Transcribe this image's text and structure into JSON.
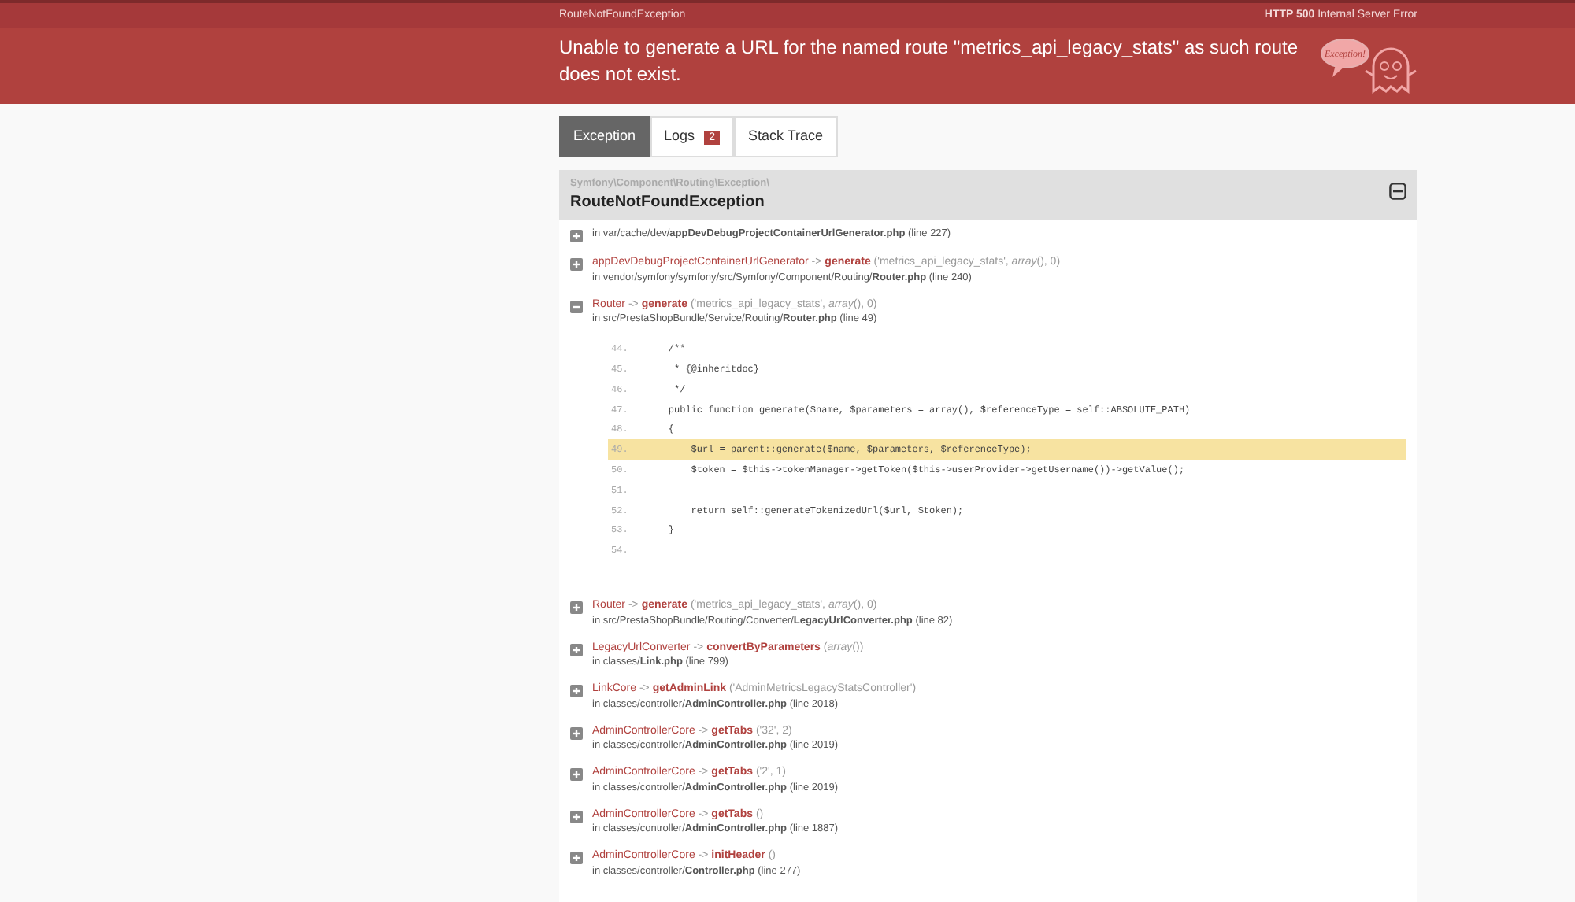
{
  "header": {
    "exception_name": "RouteNotFoundException",
    "status": "**HTTP 500** Internal Server Error",
    "message": "Unable to generate a URL for the named route \"metrics_api_legacy_stats\" as such route does not exist.",
    "logo_text": "Exception!"
  },
  "tabs": [
    {
      "label": "Exception",
      "selected": true
    },
    {
      "label": "Logs",
      "badge": "2",
      "selected": false
    },
    {
      "label": "Stack Trace",
      "selected": false
    }
  ],
  "exception": {
    "namespace": "Symfony\\Component\\Routing\\Exception\\",
    "class": "RouteNotFoundException",
    "expanded": true,
    "frames": [
      {
        "path": "in var/cache/dev/**appDevDebugProjectContainerUrlGenerator.php** (line 227)",
        "expanded": false
      },
      {
        "class": "appDevDebugProjectContainerUrlGenerator",
        "separator": "->",
        "call": "generate",
        "args": "('metrics_api_legacy_stats', *array*(), 0)",
        "path": "in vendor/symfony/symfony/src/Symfony/Component/Routing/**Router.php** (line 240)",
        "expanded": false
      },
      {
        "class": "Router",
        "separator": "->",
        "call": "generate",
        "args": "('metrics_api_legacy_stats', *array*(), 0)",
        "path": "in src/PrestaShopBundle/Service/Routing/**Router.php** (line 49)",
        "expanded": true,
        "code": [
          {
            "number": "44.",
            "text": "    /**",
            "highlighted": false
          },
          {
            "number": "45.",
            "text": "     * {@inheritdoc}",
            "highlighted": false
          },
          {
            "number": "46.",
            "text": "     */",
            "highlighted": false
          },
          {
            "number": "47.",
            "text": "    public function generate($name, $parameters = array(), $referenceType = self::ABSOLUTE_PATH)",
            "highlighted": false
          },
          {
            "number": "48.",
            "text": "    {",
            "highlighted": false
          },
          {
            "number": "49.",
            "text": "        $url = parent::generate($name, $parameters, $referenceType);",
            "highlighted": true
          },
          {
            "number": "50.",
            "text": "        $token = $this->tokenManager->getToken($this->userProvider->getUsername())->getValue();",
            "highlighted": false
          },
          {
            "number": "51.",
            "highlighted": false
          },
          {
            "number": "52.",
            "text": "        return self::generateTokenizedUrl($url, $token);",
            "highlighted": false
          },
          {
            "number": "53.",
            "text": "    }",
            "highlighted": false
          },
          {
            "number": "54.",
            "highlighted": false
          }
        ]
      },
      {
        "class": "Router",
        "separator": "->",
        "call": "generate",
        "args": "('metrics_api_legacy_stats', *array*(), 0)",
        "path": "in src/PrestaShopBundle/Routing/Converter/**LegacyUrlConverter.php** (line 82)",
        "expanded": false
      },
      {
        "class": "LegacyUrlConverter",
        "separator": "->",
        "call": "convertByParameters",
        "args": "(*array*())",
        "path": "in classes/**Link.php** (line 799)",
        "expanded": false
      },
      {
        "class": "LinkCore",
        "separator": "->",
        "call": "getAdminLink",
        "args": "('AdminMetricsLegacyStatsController')",
        "path": "in classes/controller/**AdminController.php** (line 2018)",
        "expanded": false
      },
      {
        "class": "AdminControllerCore",
        "separator": "->",
        "call": "getTabs",
        "args": "('32', 2)",
        "path": "in classes/controller/**AdminController.php** (line 2019)",
        "expanded": false
      },
      {
        "class": "AdminControllerCore",
        "separator": "->",
        "call": "getTabs",
        "args": "('2', 1)",
        "path": "in classes/controller/**AdminController.php** (line 2019)",
        "expanded": false
      },
      {
        "class": "AdminControllerCore",
        "separator": "->",
        "call": "getTabs",
        "args": "()",
        "path": "in classes/controller/**AdminController.php** (line 1887)",
        "expanded": false
      },
      {
        "class": "AdminControllerCore",
        "separator": "->",
        "call": "initHeader",
        "args": "()",
        "path": "in classes/controller/**Controller.php** (line 277)",
        "expanded": false
      }
    ]
  }
}
